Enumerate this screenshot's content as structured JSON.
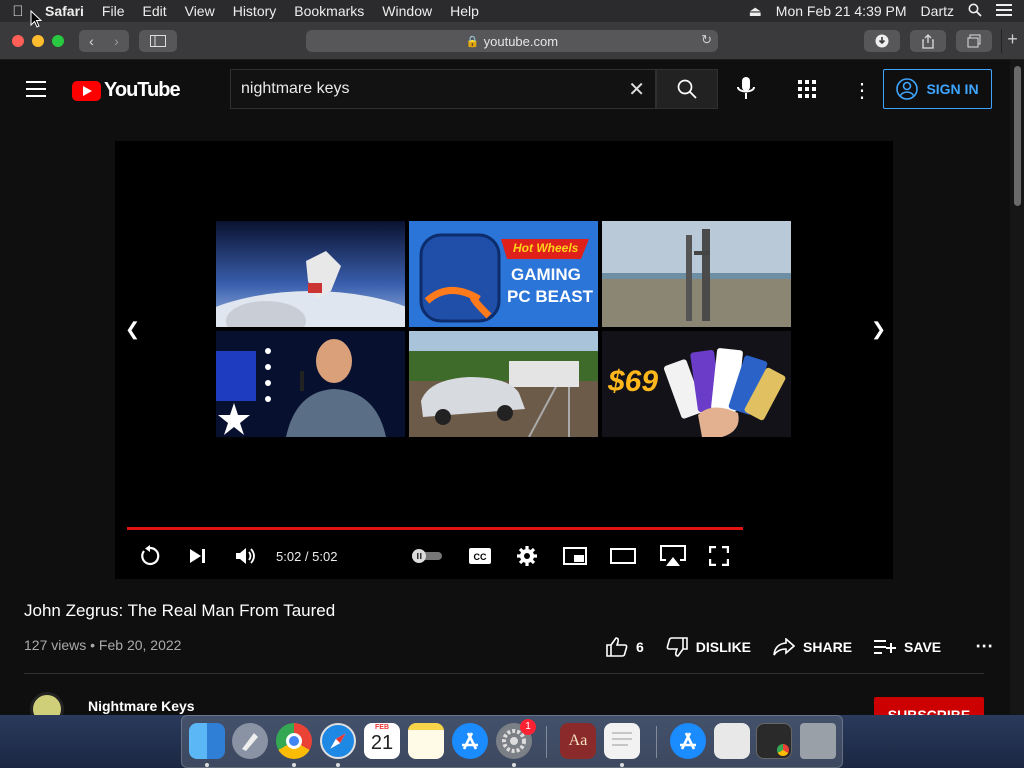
{
  "menubar": {
    "apple_icon": "apple-logo",
    "items": [
      "Safari",
      "File",
      "Edit",
      "View",
      "History",
      "Bookmarks",
      "Window",
      "Help"
    ],
    "datetime": "Mon Feb 21  4:39 PM",
    "user": "Dartz"
  },
  "browser": {
    "url": "youtube.com"
  },
  "youtube": {
    "logo_text": "YouTube",
    "search_value": "nightmare keys",
    "signin_label": "SIGN IN"
  },
  "player": {
    "time": "5:02 / 5:02",
    "progress": 1.0,
    "thumb_texts": {
      "gaming_line1": "GAMING",
      "gaming_line2": "PC BEAST",
      "hot_wheels": "Hot Wheels",
      "price": "$69"
    }
  },
  "video": {
    "title": "John Zegrus: The Real Man From Taured",
    "meta": "127 views • Feb 20, 2022",
    "likes": "6",
    "dislike_label": "DISLIKE",
    "share_label": "SHARE",
    "save_label": "SAVE",
    "channel_name": "Nightmare Keys",
    "subscribe_label": "SUBSCRIBE"
  },
  "dock": {
    "calendar_month": "FEB",
    "calendar_day": "21",
    "settings_badge": "1",
    "dictionary_glyph": "Aa"
  },
  "colors": {
    "accent_blue": "#3ea6ff",
    "youtube_red": "#ff0000",
    "progress_red": "#e31212"
  }
}
